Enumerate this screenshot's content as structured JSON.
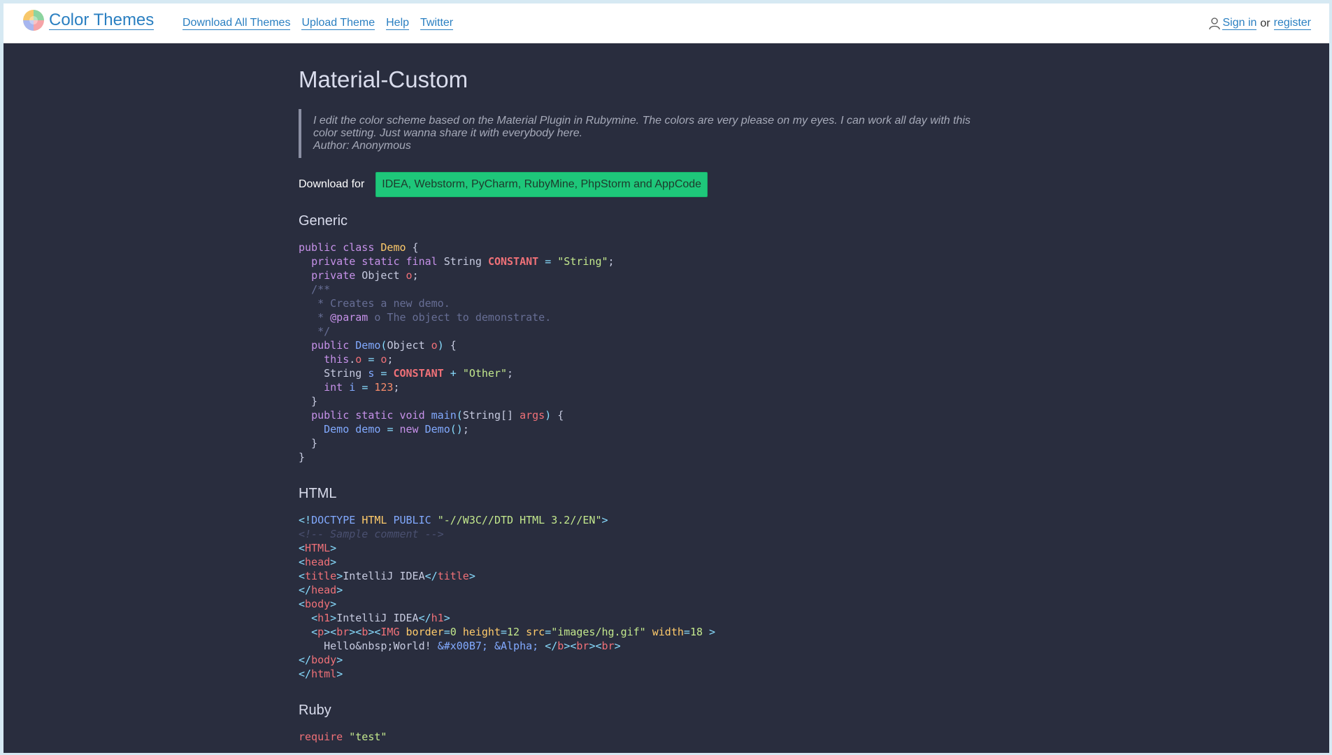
{
  "header": {
    "brand": "Color Themes",
    "nav": [
      "Download All Themes",
      "Upload Theme",
      "Help",
      "Twitter"
    ],
    "sign_in": "Sign in",
    "or": "or",
    "register": "register"
  },
  "theme": {
    "title": "Material-Custom",
    "description": "I edit the color scheme based on the Material Plugin in Rubymine. The colors are very please on my eyes. I can work all day with this color setting. Just wanna share it with everybody here.",
    "author": "Author: Anonymous",
    "download_label": "Download for",
    "download_button": "IDEA, Webstorm, PyCharm, RubyMine, PhpStorm and AppCode"
  },
  "sections": {
    "generic": "Generic",
    "html": "HTML",
    "ruby": "Ruby"
  },
  "colors": {
    "background": "#292d3e",
    "link": "#2a7fc1",
    "download_button": "#1ec77a"
  }
}
